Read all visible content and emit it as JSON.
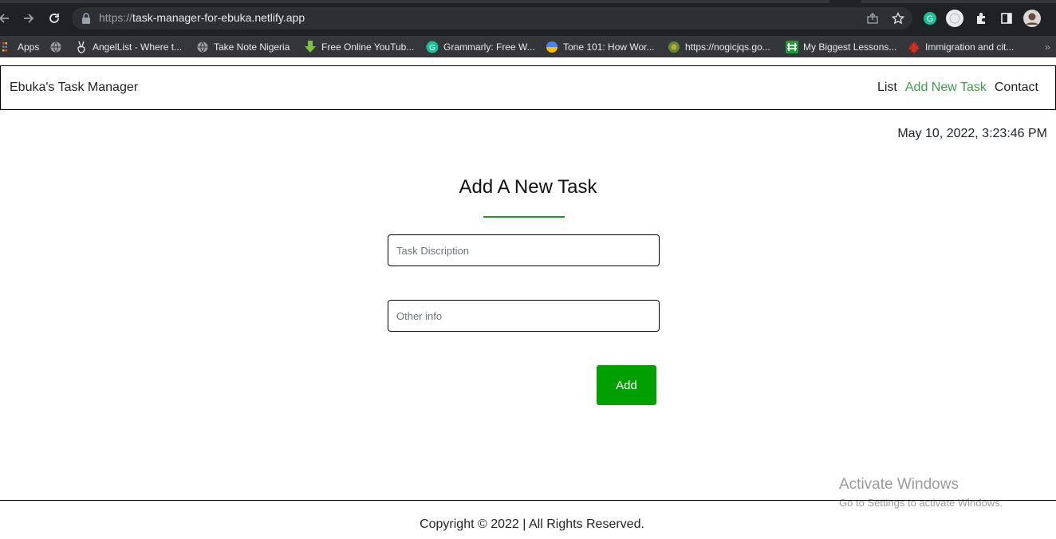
{
  "browser": {
    "url_scheme": "https://",
    "url_host": "task-manager-for-ebuka.netlify.app",
    "bookmarks": [
      {
        "label": "Apps",
        "icon": "apps-grid-icon"
      },
      {
        "label": "",
        "icon": "globe-icon"
      },
      {
        "label": "AngelList - Where t...",
        "icon": "angellist-icon"
      },
      {
        "label": "Take Note Nigeria",
        "icon": "globe-icon"
      },
      {
        "label": "Free Online YouTub...",
        "icon": "download-arrow-icon"
      },
      {
        "label": "Grammarly: Free W...",
        "icon": "grammarly-icon"
      },
      {
        "label": "Tone 101: How Wor...",
        "icon": "google-icon"
      },
      {
        "label": "https://nogicjqs.go...",
        "icon": "crest-icon"
      },
      {
        "label": "My Biggest Lessons...",
        "icon": "hashnode-icon"
      },
      {
        "label": "Immigration and cit...",
        "icon": "maple-leaf-icon"
      }
    ]
  },
  "navbar": {
    "brand": "Ebuka's Task Manager",
    "links": [
      "List",
      "Add New Task",
      "Contact"
    ],
    "active_link": "Add New Task"
  },
  "datetime": "May 10, 2022, 3:23:46 PM",
  "form": {
    "title": "Add A New Task",
    "task_placeholder": "Task Discription",
    "other_placeholder": "Other info",
    "task_value": "",
    "other_value": "",
    "submit_label": "Add"
  },
  "watermark": {
    "line1": "Activate Windows",
    "line2": "Go to Settings to activate Windows."
  },
  "footer": {
    "text": "Copyright © 2022 | All Rights Reserved."
  },
  "colors": {
    "accent_green": "#00a000",
    "active_link": "#3ca047",
    "chrome_dark": "#202124"
  }
}
